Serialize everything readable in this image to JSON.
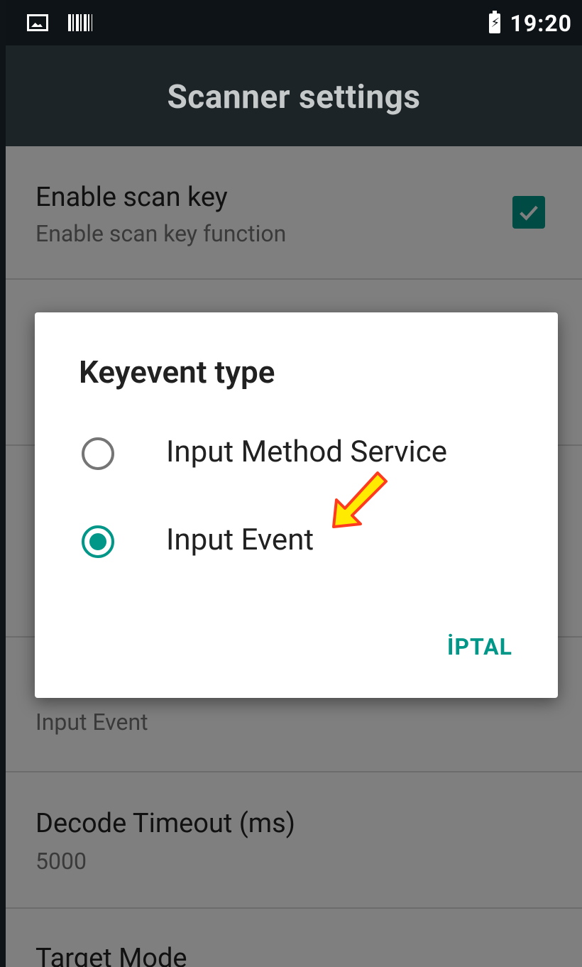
{
  "status_bar": {
    "icons": [
      "image-notification-icon",
      "barcode-notification-icon",
      "battery-charging-icon"
    ],
    "time": "19:20"
  },
  "app_bar": {
    "title": "Scanner settings"
  },
  "settings": {
    "enable_scan_key": {
      "title": "Enable scan key",
      "summary": "Enable scan key function",
      "checked": true
    },
    "keyevent_type": {
      "summary": "Input Event"
    },
    "decode_timeout": {
      "title": "Decode Timeout (ms)",
      "summary": "5000"
    },
    "target_mode": {
      "title": "Target Mode"
    }
  },
  "dialog": {
    "title": "Keyevent type",
    "options": [
      {
        "label": "Input Method Service",
        "selected": false
      },
      {
        "label": "Input Event",
        "selected": true
      }
    ],
    "cancel_label": "İPTAL"
  },
  "colors": {
    "accent": "#009688",
    "status_bar": "#0d1316",
    "app_bar": "#1c2427",
    "arrow_fill": "#ffea00",
    "arrow_stroke": "#ff3b1f"
  }
}
